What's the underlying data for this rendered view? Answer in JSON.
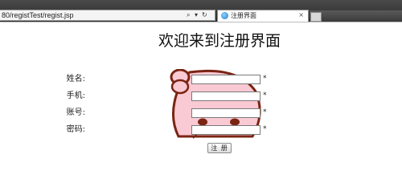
{
  "browser": {
    "url": "80/registTest/regist.jsp",
    "tab_title": "注册界面",
    "tab_close": "×",
    "search_glyph": "⌕",
    "dropdown_glyph": "▾",
    "refresh_glyph": "↻"
  },
  "page": {
    "title": "欢迎来到注册界面"
  },
  "form": {
    "fields": [
      {
        "label": "姓名:",
        "value": "",
        "required_mark": "*"
      },
      {
        "label": "手机:",
        "value": "",
        "required_mark": "*"
      },
      {
        "label": "账号:",
        "value": "",
        "required_mark": "*"
      },
      {
        "label": "密码:",
        "value": "",
        "required_mark": "*"
      }
    ],
    "submit_label": "注 册"
  },
  "colors": {
    "background_art_pink": "#f9c9d4",
    "background_art_outline": "#7a2412"
  }
}
